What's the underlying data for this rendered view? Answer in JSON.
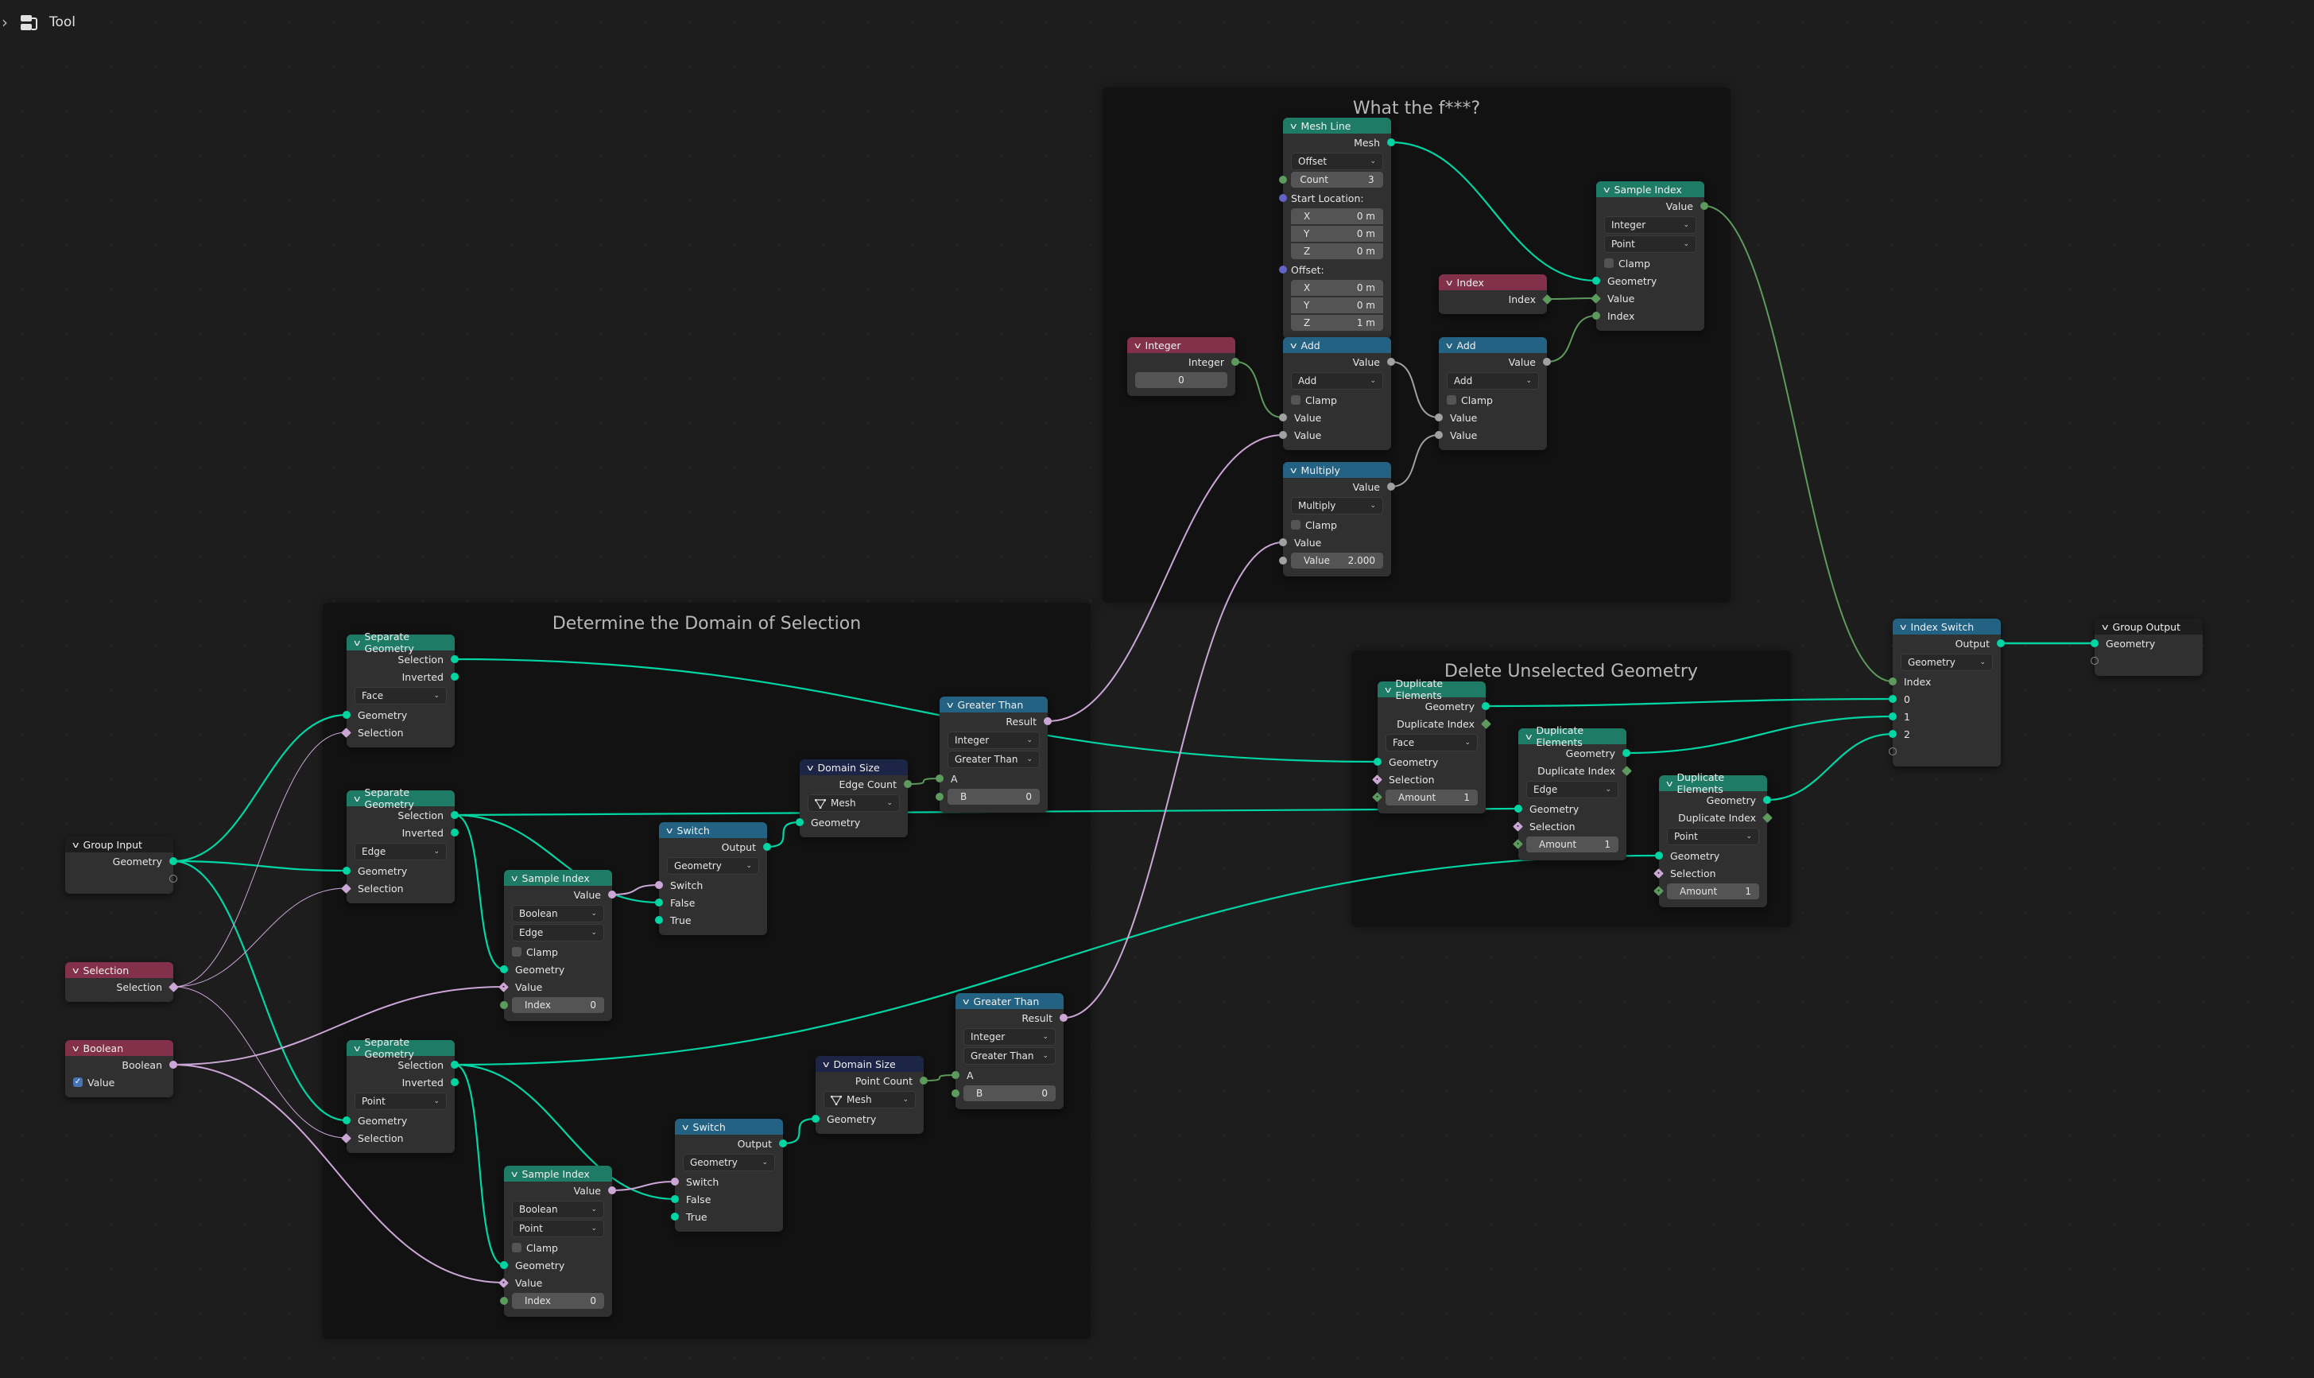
{
  "topbar": {
    "title": "Tool",
    "icon": "node-tree-icon"
  },
  "colors": {
    "geometry": "#00d6a3",
    "boolean": "#cca6d6",
    "integer": "#5d9a5d",
    "float": "#a1a1a1",
    "vector": "#6363c7",
    "header_geometry": "#1e7b66",
    "header_math": "#246283",
    "header_input": "#83314a",
    "header_attribute": "#1d2546"
  },
  "frames": {
    "what": {
      "title": "What the f***?"
    },
    "domain": {
      "title": "Determine the Domain of Selection"
    },
    "delete": {
      "title": "Delete Unselected Geometry"
    }
  },
  "nodes": {
    "group_input": {
      "title": "Group Input",
      "out_geometry": "Geometry"
    },
    "selection": {
      "title": "Selection",
      "out": "Selection"
    },
    "boolean": {
      "title": "Boolean",
      "out": "Boolean",
      "value_label": "Value",
      "value_checked": true
    },
    "sep_face": {
      "title": "Separate Geometry",
      "out1": "Selection",
      "out2": "Inverted",
      "domain": "Face",
      "in1": "Geometry",
      "in2": "Selection"
    },
    "sep_edge": {
      "title": "Separate Geometry",
      "out1": "Selection",
      "out2": "Inverted",
      "domain": "Edge",
      "in1": "Geometry",
      "in2": "Selection"
    },
    "sep_point": {
      "title": "Separate Geometry",
      "out1": "Selection",
      "out2": "Inverted",
      "domain": "Point",
      "in1": "Geometry",
      "in2": "Selection"
    },
    "sample_edge": {
      "title": "Sample Index",
      "out": "Value",
      "type": "Boolean",
      "domain": "Edge",
      "clamp": "Clamp",
      "in1": "Geometry",
      "in2": "Value",
      "index_label": "Index",
      "index_value": "0"
    },
    "sample_point": {
      "title": "Sample Index",
      "out": "Value",
      "type": "Boolean",
      "domain": "Point",
      "clamp": "Clamp",
      "in1": "Geometry",
      "in2": "Value",
      "index_label": "Index",
      "index_value": "0"
    },
    "switch_edge": {
      "title": "Switch",
      "out": "Output",
      "type": "Geometry",
      "in1": "Switch",
      "in2": "False",
      "in3": "True"
    },
    "switch_point": {
      "title": "Switch",
      "out": "Output",
      "type": "Geometry",
      "in1": "Switch",
      "in2": "False",
      "in3": "True"
    },
    "domain_edge": {
      "title": "Domain Size",
      "out": "Edge Count",
      "component": "Mesh",
      "in": "Geometry"
    },
    "domain_point": {
      "title": "Domain Size",
      "out": "Point Count",
      "component": "Mesh",
      "in": "Geometry"
    },
    "gt_edge": {
      "title": "Greater Than",
      "out": "Result",
      "type": "Integer",
      "op": "Greater Than",
      "in_a": "A",
      "b_label": "B",
      "b_value": "0"
    },
    "gt_point": {
      "title": "Greater Than",
      "out": "Result",
      "type": "Integer",
      "op": "Greater Than",
      "in_a": "A",
      "b_label": "B",
      "b_value": "0"
    },
    "mesh_line": {
      "title": "Mesh Line",
      "out": "Mesh",
      "mode": "Offset",
      "count_label": "Count",
      "count_value": "3",
      "start_label": "Start Location:",
      "start": [
        {
          "axis": "X",
          "value": "0 m"
        },
        {
          "axis": "Y",
          "value": "0 m"
        },
        {
          "axis": "Z",
          "value": "0 m"
        }
      ],
      "offset_label": "Offset:",
      "offset": [
        {
          "axis": "X",
          "value": "0 m"
        },
        {
          "axis": "Y",
          "value": "0 m"
        },
        {
          "axis": "Z",
          "value": "1 m"
        }
      ]
    },
    "integer": {
      "title": "Integer",
      "out": "Integer",
      "value": "0"
    },
    "add1": {
      "title": "Add",
      "out": "Value",
      "op": "Add",
      "clamp": "Clamp",
      "in1": "Value",
      "in2": "Value"
    },
    "add2": {
      "title": "Add",
      "out": "Value",
      "op": "Add",
      "clamp": "Clamp",
      "in1": "Value",
      "in2": "Value"
    },
    "multiply": {
      "title": "Multiply",
      "out": "Value",
      "op": "Multiply",
      "clamp": "Clamp",
      "in1": "Value",
      "field_label": "Value",
      "field_value": "2.000"
    },
    "index": {
      "title": "Index",
      "out": "Index"
    },
    "sample_top": {
      "title": "Sample Index",
      "out": "Value",
      "type": "Integer",
      "domain": "Point",
      "clamp": "Clamp",
      "in1": "Geometry",
      "in2": "Value",
      "in3": "Index"
    },
    "dup_face": {
      "title": "Duplicate Elements",
      "out1": "Geometry",
      "out2": "Duplicate Index",
      "domain": "Face",
      "in1": "Geometry",
      "in2": "Selection",
      "amount_label": "Amount",
      "amount_value": "1"
    },
    "dup_edge": {
      "title": "Duplicate Elements",
      "out1": "Geometry",
      "out2": "Duplicate Index",
      "domain": "Edge",
      "in1": "Geometry",
      "in2": "Selection",
      "amount_label": "Amount",
      "amount_value": "1"
    },
    "dup_point": {
      "title": "Duplicate Elements",
      "out1": "Geometry",
      "out2": "Duplicate Index",
      "domain": "Point",
      "in1": "Geometry",
      "in2": "Selection",
      "amount_label": "Amount",
      "amount_value": "1"
    },
    "index_switch": {
      "title": "Index Switch",
      "out": "Output",
      "type": "Geometry",
      "in_index": "Index",
      "items": [
        "0",
        "1",
        "2"
      ]
    },
    "group_output": {
      "title": "Group Output",
      "in": "Geometry"
    }
  }
}
